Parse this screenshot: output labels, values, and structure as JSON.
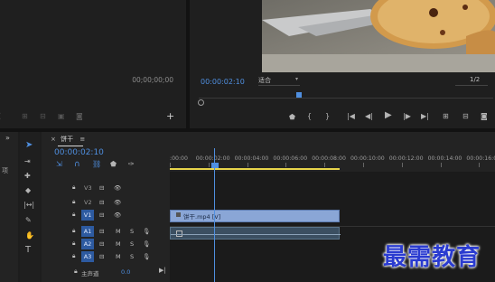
{
  "source_monitor": {
    "timecode": "00;00;00;00"
  },
  "program_monitor": {
    "timecode": "00:00:02:10",
    "fit_label": "适合",
    "resolution": "1/2"
  },
  "timeline": {
    "sequence_name": "饼干",
    "menu_glyph": "≡",
    "close_glyph": "×",
    "playhead_timecode": "00:00:02:10",
    "ruler_labels": [
      ":00:00",
      "00:00:02:00",
      "00:00:04:00",
      "00:00:06:00",
      "00:00:08:00",
      "00:00:10:00",
      "00:00:12:00",
      "00:00:14:00",
      "00:00:16:00"
    ],
    "video_tracks": [
      {
        "name": "V3",
        "target": ""
      },
      {
        "name": "V2",
        "target": ""
      },
      {
        "name": "V1",
        "target": "V1"
      }
    ],
    "audio_tracks": [
      {
        "name": "A1",
        "target": "A1",
        "m": "M",
        "s": "S"
      },
      {
        "name": "A2",
        "target": "A2",
        "m": "M",
        "s": "S"
      },
      {
        "name": "A3",
        "target": "A3",
        "m": "M",
        "s": "S"
      }
    ],
    "master_label": "主声道",
    "master_value": "0.0",
    "video_clip_label": "饼干.mp4 [V]",
    "left_panel_label": "项"
  },
  "watermark": "最需教育"
}
